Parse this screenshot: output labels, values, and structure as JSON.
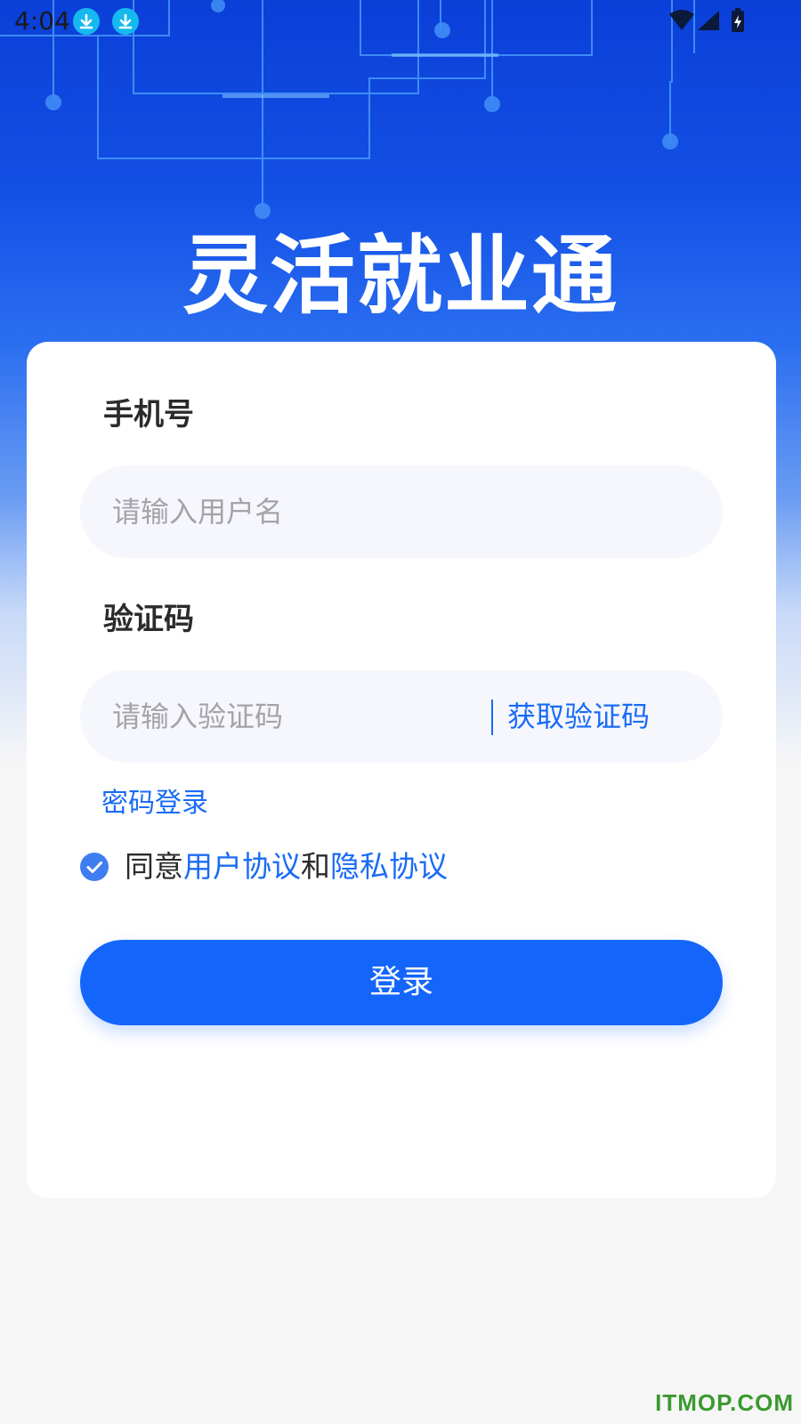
{
  "status_bar": {
    "time": "4:04",
    "left_icons": [
      "download-icon",
      "download-icon"
    ],
    "right_icons": [
      "wifi-icon",
      "signal-icon",
      "battery-charging-icon"
    ]
  },
  "app": {
    "title": "灵活就业通"
  },
  "form": {
    "phone_label": "手机号",
    "phone_placeholder": "请输入用户名",
    "code_label": "验证码",
    "code_placeholder": "请输入验证码",
    "get_code": "获取验证码",
    "password_login": "密码登录"
  },
  "agreement": {
    "checked": true,
    "prefix": "同意",
    "user_agreement": "用户协议",
    "conjunction": "和",
    "privacy_agreement": "隐私协议"
  },
  "login_button": "登录",
  "watermark": "ITMOP.COM",
  "colors": {
    "accent": "#1466fb",
    "link": "#1a6bf5",
    "hero_top": "#0a3fd8",
    "background": "#f6f6f7"
  }
}
